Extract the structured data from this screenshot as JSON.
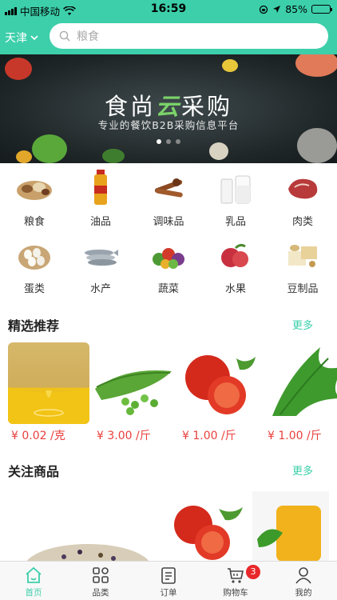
{
  "status_bar": {
    "carrier": "中国移动",
    "time": "16:59",
    "battery": "85%",
    "battery_level": 0.85
  },
  "header": {
    "city": "天津",
    "search_placeholder": "粮食"
  },
  "banner": {
    "title_left": "食尚",
    "title_accent": "云",
    "title_right": "采购",
    "subtitle": "专业的餐饮B2B采购信息平台",
    "slide_count": 3,
    "active_slide": 1
  },
  "categories": [
    {
      "label": "粮食",
      "icon": "grain-icon"
    },
    {
      "label": "油品",
      "icon": "oil-bottle-icon"
    },
    {
      "label": "调味品",
      "icon": "spice-icon"
    },
    {
      "label": "乳品",
      "icon": "milk-icon"
    },
    {
      "label": "肉类",
      "icon": "meat-icon"
    },
    {
      "label": "蛋类",
      "icon": "egg-icon"
    },
    {
      "label": "水产",
      "icon": "fish-icon"
    },
    {
      "label": "蔬菜",
      "icon": "vegetable-icon"
    },
    {
      "label": "水果",
      "icon": "fruit-icon"
    },
    {
      "label": "豆制品",
      "icon": "tofu-icon"
    }
  ],
  "featured": {
    "title": "精选推荐",
    "more": "更多",
    "items": [
      {
        "price": "¥ 0.02 /克",
        "image": "soybean-oil-image"
      },
      {
        "price": "¥ 3.00 /斤",
        "image": "green-peas-image"
      },
      {
        "price": "¥ 1.00 /斤",
        "image": "tomato-image"
      },
      {
        "price": "¥ 1.00 /斤",
        "image": "leafy-greens-image"
      }
    ]
  },
  "watched": {
    "title": "关注商品",
    "more": "更多"
  },
  "tabbar": {
    "items": [
      {
        "label": "首页",
        "icon": "home-icon",
        "active": true
      },
      {
        "label": "品类",
        "icon": "category-grid-icon",
        "active": false
      },
      {
        "label": "订单",
        "icon": "order-list-icon",
        "active": false
      },
      {
        "label": "购物车",
        "icon": "cart-icon",
        "active": false
      },
      {
        "label": "我的",
        "icon": "user-icon",
        "active": false
      }
    ],
    "cart_badge": "3"
  },
  "colors": {
    "accent": "#3ccfaa",
    "price": "#e8403c",
    "badge": "#e8282a"
  }
}
